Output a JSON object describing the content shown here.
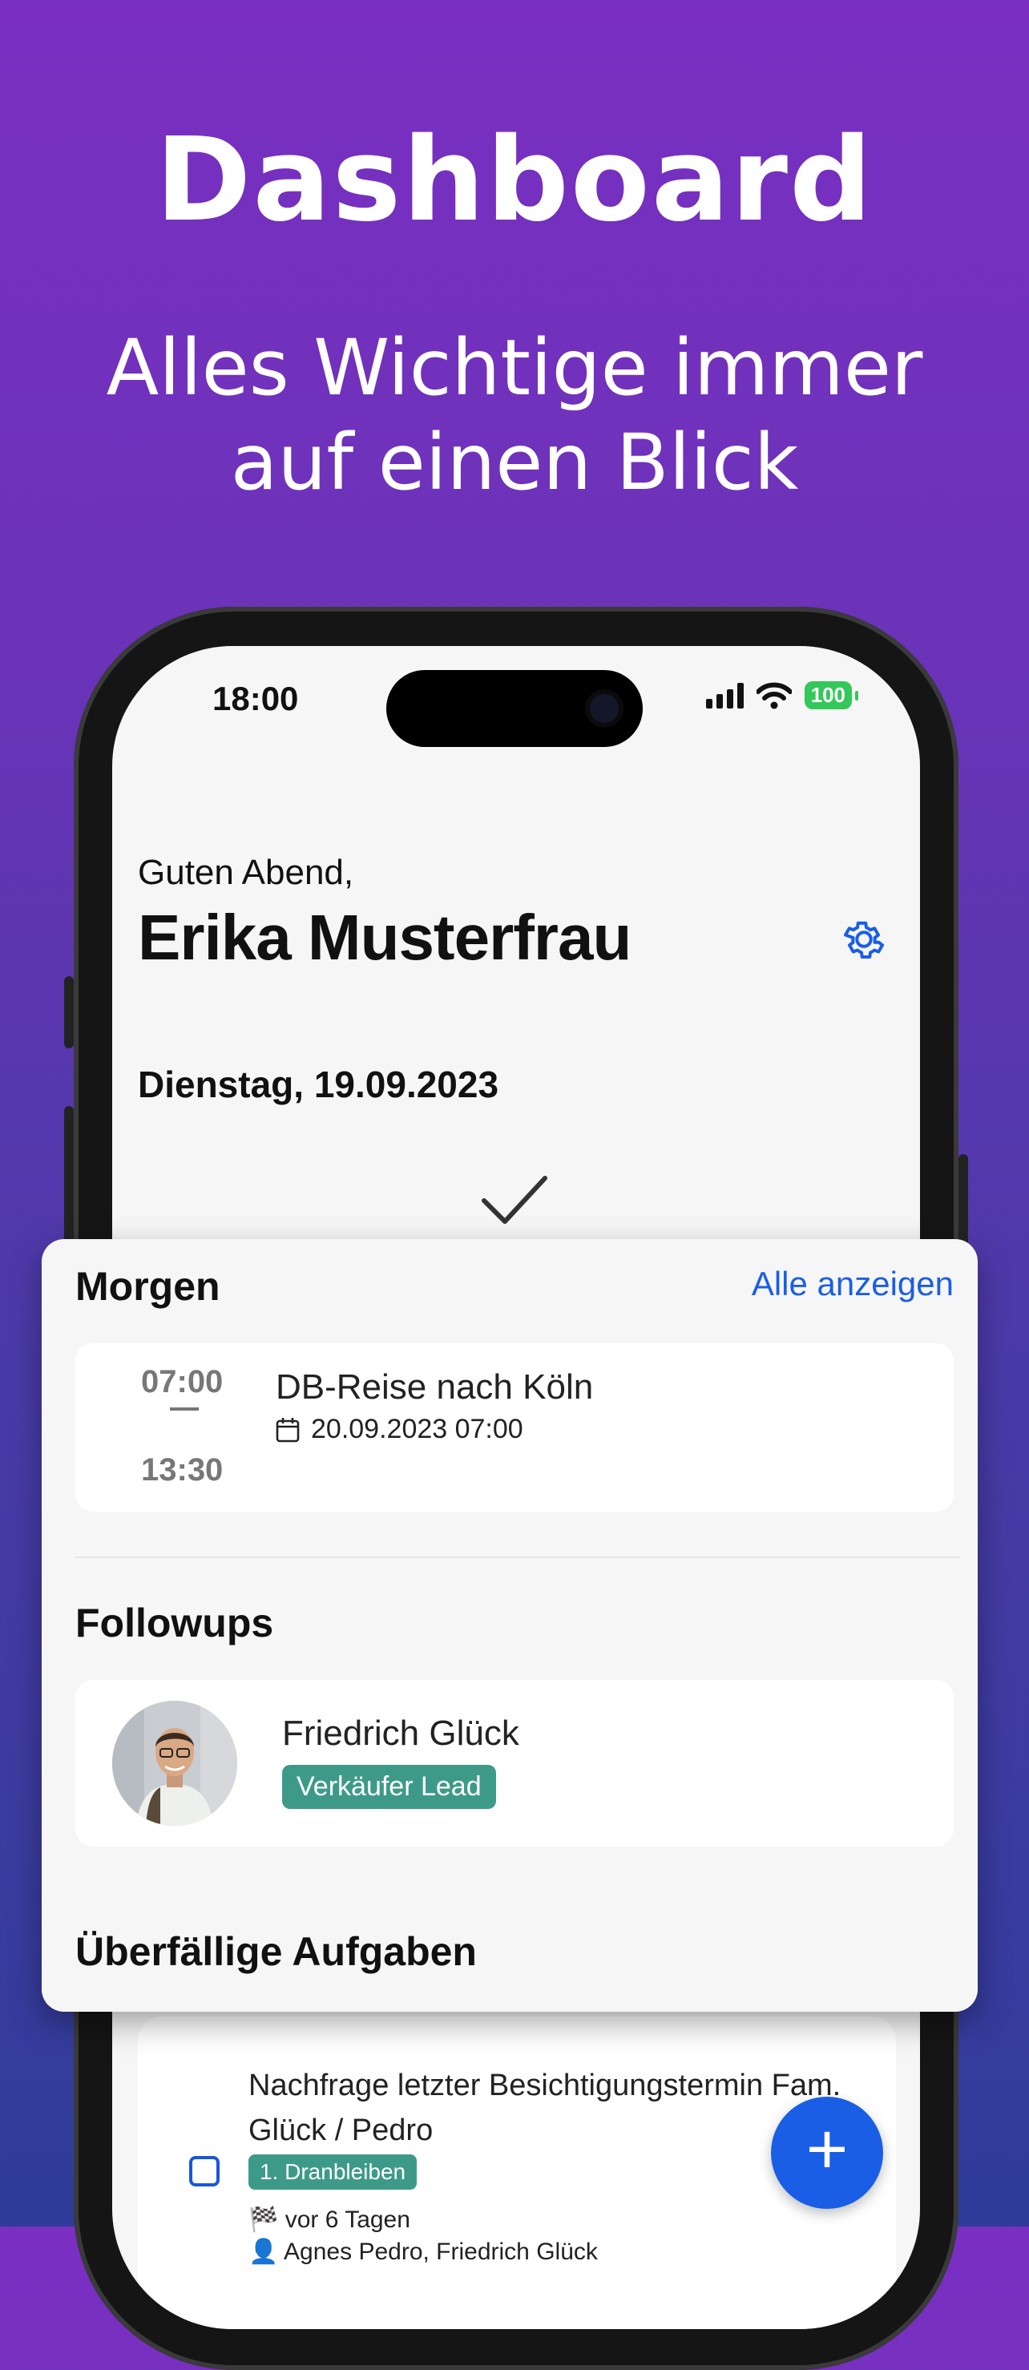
{
  "hero": {
    "title": "Dashboard",
    "subtitle_line1": "Alles Wichtige immer",
    "subtitle_line2": "auf einen Blick"
  },
  "status_bar": {
    "time": "18:00",
    "battery": "100"
  },
  "header": {
    "greeting": "Guten Abend,",
    "user_name": "Erika Musterfrau",
    "date": "Dienstag, 19.09.2023"
  },
  "morgen": {
    "title": "Morgen",
    "show_all": "Alle anzeigen",
    "event": {
      "start": "07:00",
      "end": "13:30",
      "title": "DB-Reise nach Köln",
      "date": "20.09.2023 07:00"
    }
  },
  "followups": {
    "title": "Followups",
    "person": "Friedrich Glück",
    "tag": "Verkäufer Lead"
  },
  "overdue": {
    "title": "Überfällige Aufgaben",
    "task": {
      "title": "Nachfrage letzter Besichtigungstermin Fam. Glück / Pedro",
      "tag": "1. Dranbleiben",
      "due": "vor 6 Tagen",
      "people": "Agnes Pedro, Friedrich Glück"
    }
  },
  "colors": {
    "accent": "#1a5ee6",
    "tag": "#3e9a88",
    "battery": "#34c759"
  },
  "icons": {
    "settings": "gear-icon",
    "calendar": "calendar-icon",
    "add": "plus-icon"
  }
}
